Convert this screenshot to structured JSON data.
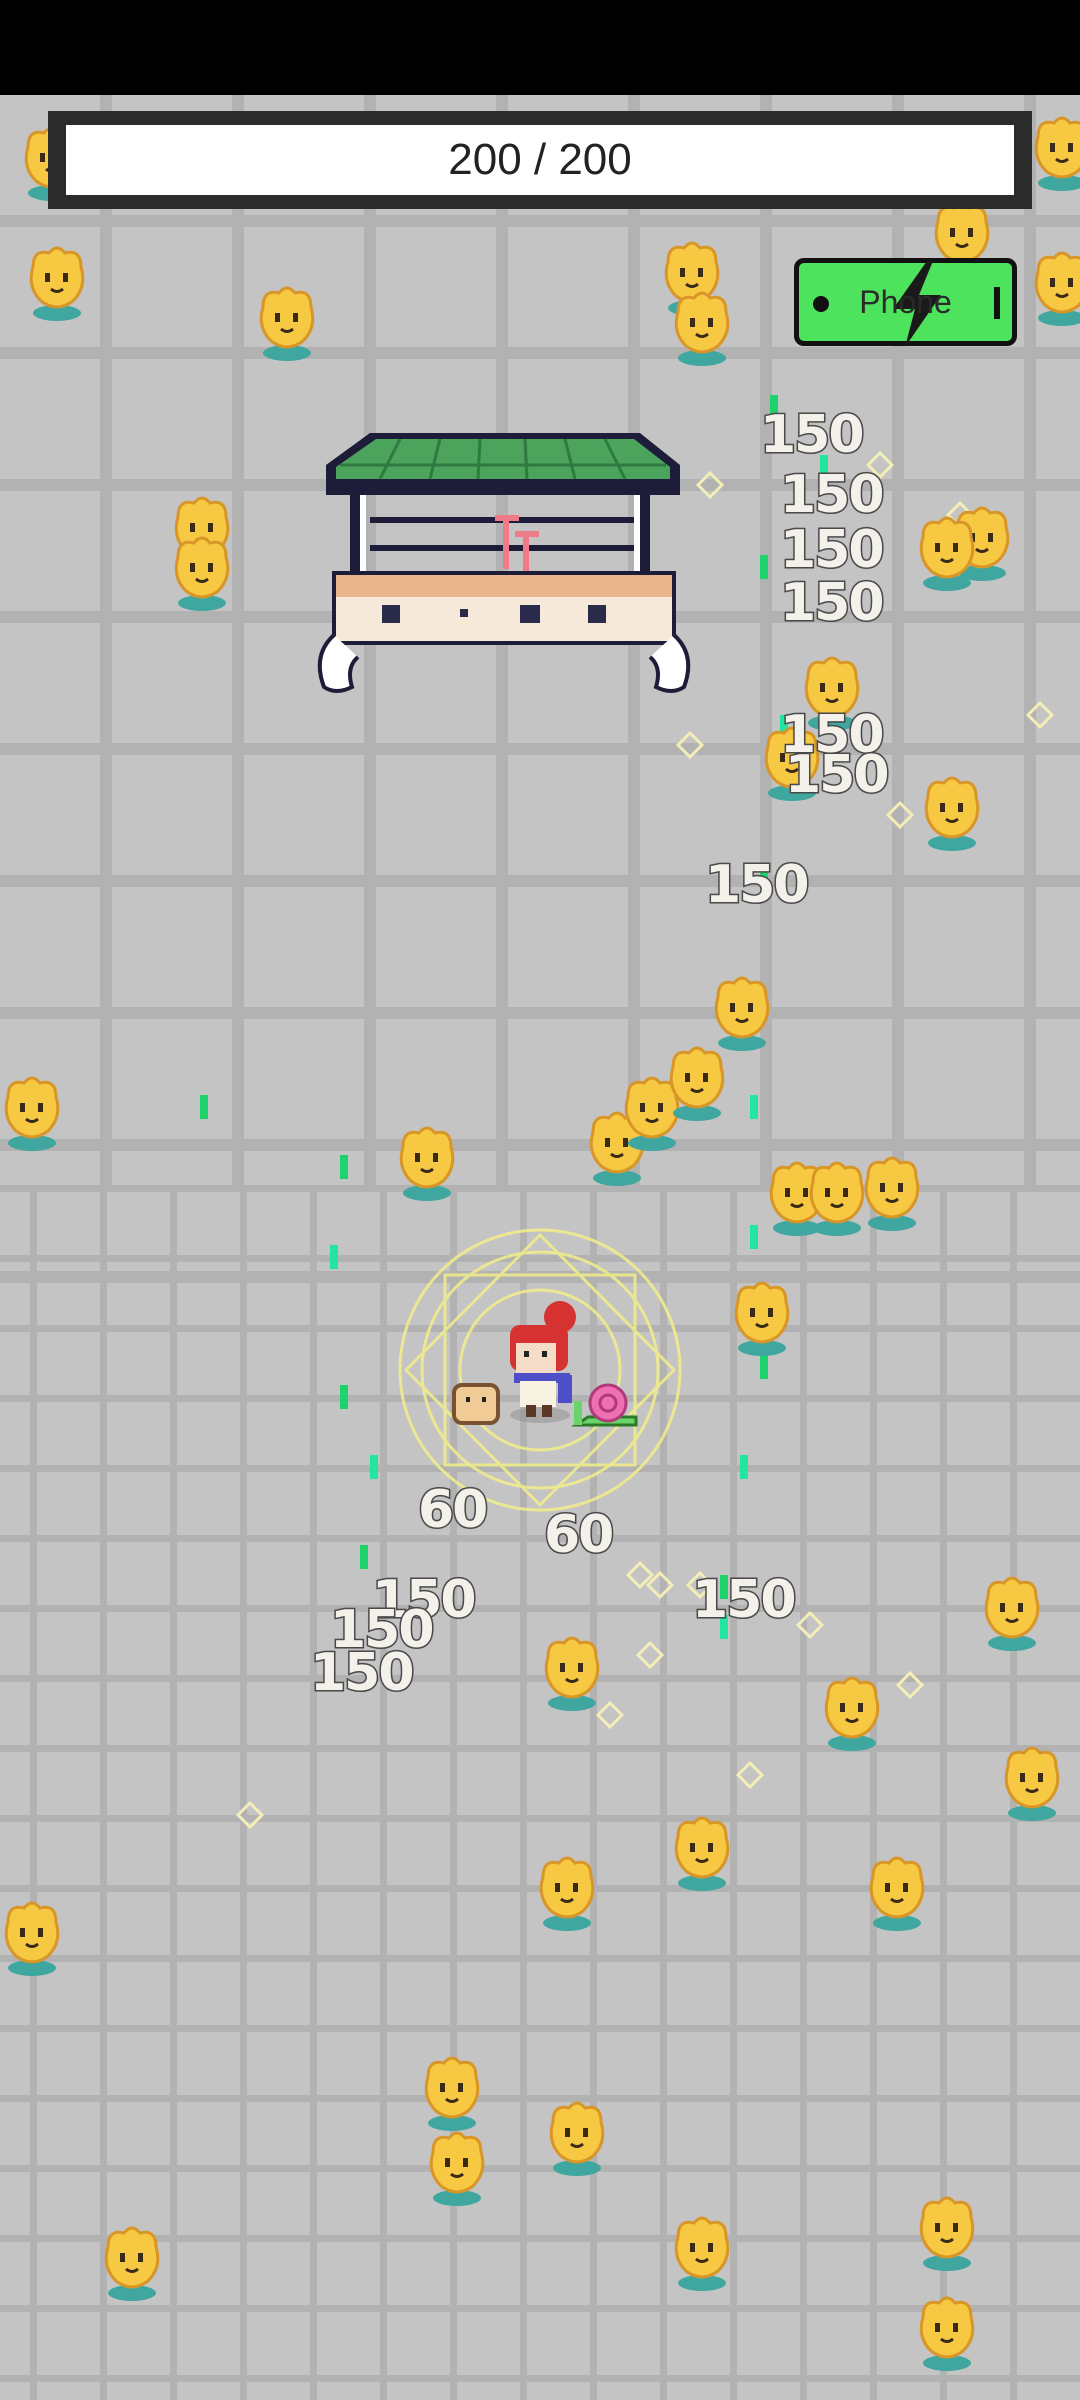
{
  "hud": {
    "hp_text": "200 / 200",
    "phone_label": "Phone"
  },
  "colors": {
    "floor": "#c4c4c4",
    "grid": "#b2b2b2",
    "enemy_body": "#f7c842",
    "enemy_shadow": "#3fa7a0",
    "phone_button": "#4ee35c",
    "spark": "#22e6a0",
    "roof": "#4ca35c"
  },
  "icons": {
    "phone": "lightning-bolt-icon",
    "enemy": "yellow-flower-sprite",
    "player": "red-hair-girl-sprite",
    "pet_bread": "toast-companion-sprite",
    "pet_snail": "pink-snail-companion-sprite"
  },
  "damage_numbers": [
    {
      "id": "d1",
      "text": "150"
    },
    {
      "id": "d2",
      "text": "150"
    },
    {
      "id": "d3",
      "text": "150"
    },
    {
      "id": "d4",
      "text": "150"
    },
    {
      "id": "d5",
      "text": "150"
    },
    {
      "id": "d6",
      "text": "150"
    },
    {
      "id": "d7",
      "text": "150"
    },
    {
      "id": "d8",
      "text": "60"
    },
    {
      "id": "d9",
      "text": "60"
    },
    {
      "id": "d10",
      "text": "150"
    },
    {
      "id": "d11",
      "text": "150"
    },
    {
      "id": "d12",
      "text": "150"
    },
    {
      "id": "d13",
      "text": "150"
    }
  ]
}
